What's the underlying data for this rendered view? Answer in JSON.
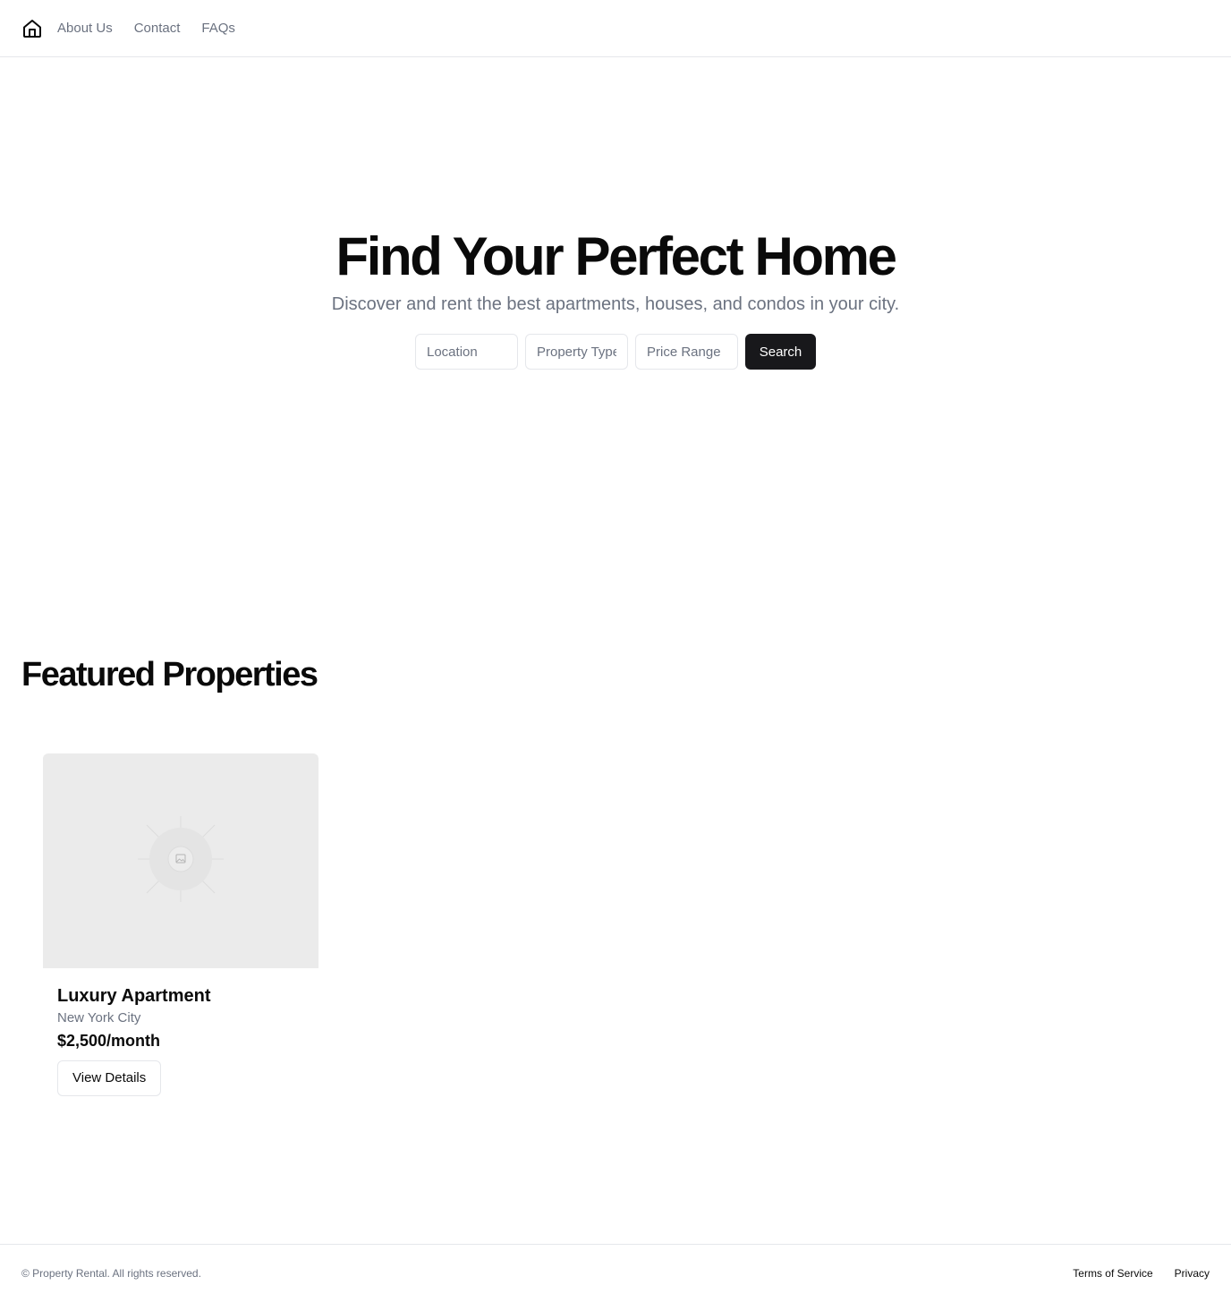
{
  "header": {
    "logo_icon": "home-icon",
    "nav": [
      {
        "label": "About Us"
      },
      {
        "label": "Contact"
      },
      {
        "label": "FAQs"
      }
    ]
  },
  "hero": {
    "title": "Find Your Perfect Home",
    "subtitle": "Discover and rent the best apartments, houses, and condos in your city.",
    "search": {
      "location_placeholder": "Location",
      "location_value": "",
      "property_type_placeholder": "Property Type",
      "property_type_value": "",
      "price_range_placeholder": "Price Range",
      "price_range_value": "",
      "button_label": "Search"
    }
  },
  "featured": {
    "title": "Featured Properties",
    "properties": [
      {
        "image_icon": "image-placeholder-icon",
        "title": "Luxury Apartment",
        "location": "New York City",
        "price": "$2,500/month",
        "button_label": "View Details"
      }
    ]
  },
  "footer": {
    "copyright": "© Property Rental. All rights reserved.",
    "links": [
      {
        "label": "Terms of Service"
      },
      {
        "label": "Privacy"
      }
    ]
  },
  "colors": {
    "primary_button": "#18181b",
    "muted_text": "#6b7280",
    "border": "#e5e7eb",
    "image_placeholder_bg": "#ebebeb"
  }
}
